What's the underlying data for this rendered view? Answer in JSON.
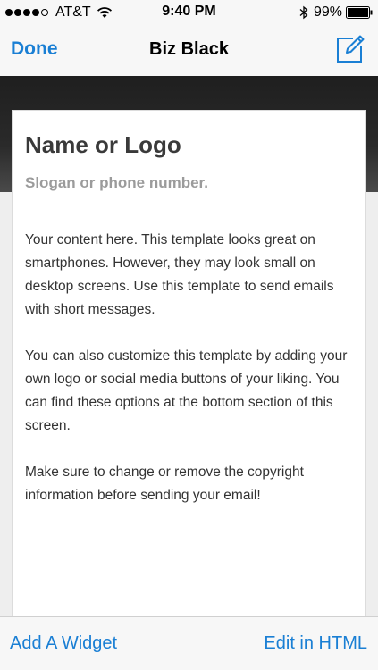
{
  "status_bar": {
    "carrier": "AT&T",
    "time": "9:40 PM",
    "battery_percent": "99%",
    "signal_icon": "signal-dots-icon",
    "wifi_icon": "wifi-icon",
    "bluetooth_icon": "bluetooth-icon",
    "battery_icon": "battery-icon"
  },
  "nav": {
    "done_label": "Done",
    "title": "Biz Black",
    "compose_icon": "compose-icon"
  },
  "email": {
    "title": "Name or Logo",
    "slogan": "Slogan or phone number.",
    "paragraphs": [
      "Your content here. This template looks great on smartphones. However, they may look small on desktop screens. Use this template to send emails with short messages.",
      "You can also customize this template by adding your own logo or social media buttons of your liking. You can find these options at the bottom section of this screen.",
      "Make sure to change or remove the copyright information before sending your email!"
    ]
  },
  "toolbar": {
    "add_widget_label": "Add A Widget",
    "edit_html_label": "Edit in HTML"
  },
  "colors": {
    "accent": "#1a7fd4",
    "header_band": "#1f1f1f",
    "title_text": "#3a3a3a",
    "slogan_text": "#9b9b9b"
  }
}
